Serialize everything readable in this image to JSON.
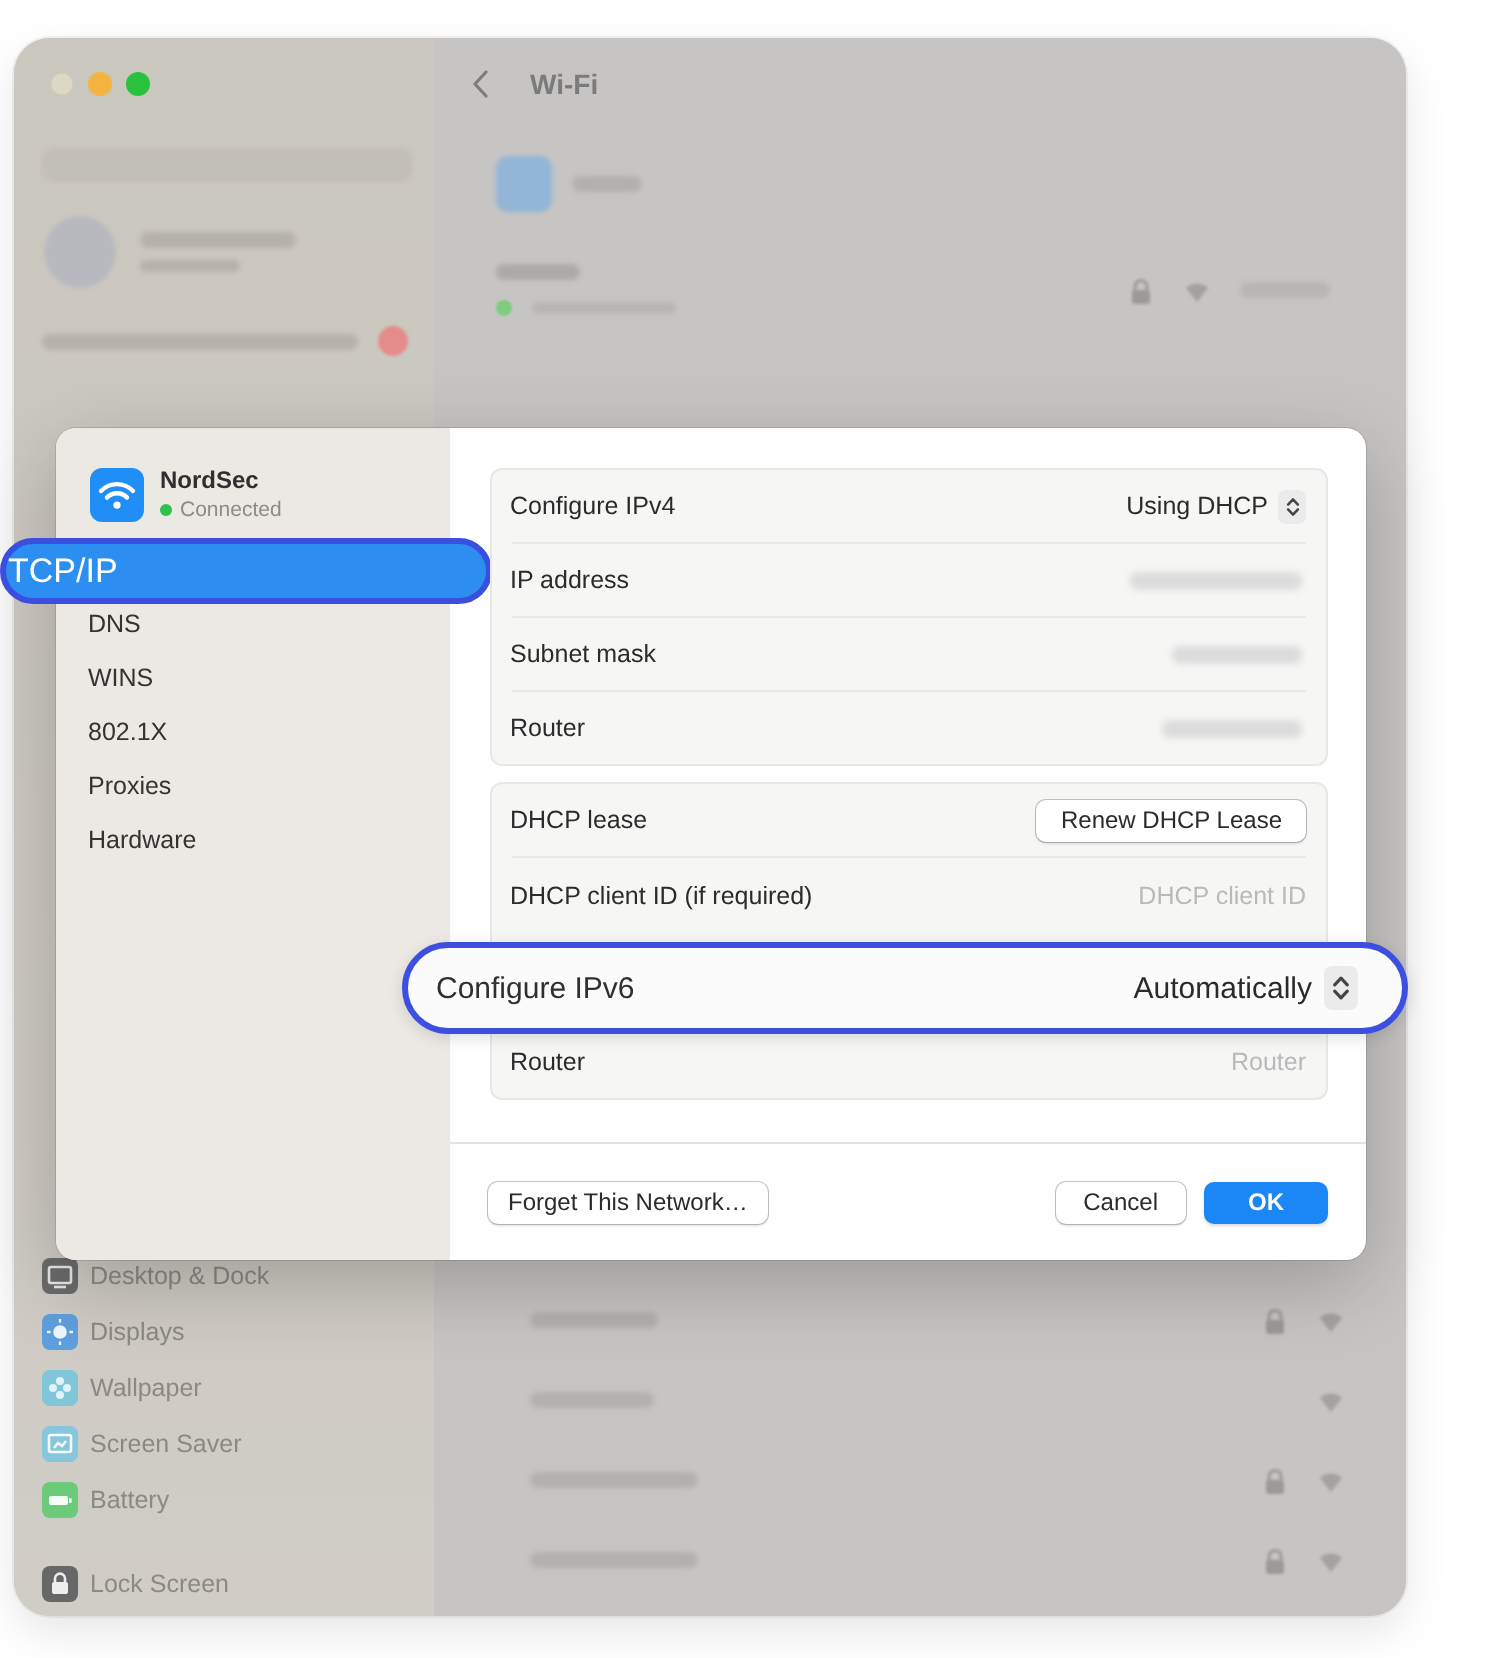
{
  "background_window": {
    "title": "Wi-Fi",
    "networks": [
      {
        "locked": true
      },
      {
        "locked": false
      },
      {
        "locked": true
      },
      {
        "locked": true
      }
    ],
    "sidebar_sections": [
      {
        "items": [
          {
            "kind": "dock",
            "label": "Desktop & Dock"
          },
          {
            "kind": "display",
            "label": "Displays"
          },
          {
            "kind": "wallpaper",
            "label": "Wallpaper"
          },
          {
            "kind": "screensaver",
            "label": "Screen Saver"
          },
          {
            "kind": "battery",
            "label": "Battery"
          }
        ]
      },
      {
        "items": [
          {
            "kind": "lock",
            "label": "Lock Screen"
          }
        ]
      }
    ]
  },
  "dialog": {
    "network": {
      "name": "NordSec",
      "status": "Connected"
    },
    "sidebar": {
      "items": [
        {
          "label": "TCP/IP",
          "selected": true
        },
        {
          "label": "DNS",
          "selected": false
        },
        {
          "label": "WINS",
          "selected": false
        },
        {
          "label": "802.1X",
          "selected": false
        },
        {
          "label": "Proxies",
          "selected": false
        },
        {
          "label": "Hardware",
          "selected": false
        }
      ]
    },
    "groups": [
      {
        "rows": [
          {
            "kind": "select",
            "label": "Configure IPv4",
            "value": "Using DHCP",
            "highlighted": false
          },
          {
            "kind": "blurred",
            "label": "IP address",
            "highlighted": false
          },
          {
            "kind": "blurred",
            "label": "Subnet mask",
            "highlighted": false
          },
          {
            "kind": "blurred",
            "label": "Router",
            "highlighted": false
          }
        ]
      },
      {
        "rows": [
          {
            "kind": "button",
            "label": "DHCP lease",
            "button": "Renew DHCP Lease",
            "highlighted": false
          },
          {
            "kind": "field",
            "label": "DHCP client ID (if required)",
            "placeholder": "DHCP client ID",
            "highlighted": false
          },
          {
            "kind": "select",
            "label": "Configure IPv6",
            "value": "Automatically",
            "highlighted": true
          },
          {
            "kind": "field",
            "label": "Router",
            "placeholder": "Router",
            "highlighted": false
          }
        ]
      }
    ],
    "footer": {
      "left_button": "Forget This Network…",
      "buttons": [
        {
          "kind": "secondary",
          "label": "Cancel"
        },
        {
          "kind": "primary",
          "label": "OK"
        }
      ]
    }
  }
}
